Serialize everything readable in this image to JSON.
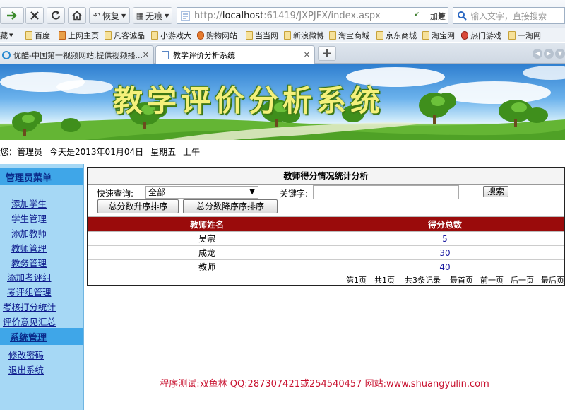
{
  "browser": {
    "nav_buttons": {
      "restore_label": "恢复",
      "no_trace_label": "无痕"
    },
    "url": {
      "scheme_host": "http://",
      "host": "localhost",
      "port_path": ":61419/JXPJFX/index.aspx"
    },
    "accelerate_label": "加速",
    "search_placeholder": "输入文字，直接搜索",
    "favorites": {
      "folder_label": "藏",
      "items": [
        "百度",
        "上网主页",
        "凡客诚品",
        "小游戏大",
        "购物网站",
        "当当网",
        "新浪微博",
        "淘宝商城",
        "京东商城",
        "淘宝网",
        "热门游戏",
        "一淘网"
      ]
    },
    "tabs": [
      {
        "label": "优酷-中国第一视频网站,提供视频播..."
      },
      {
        "label": "教学评价分析系统"
      }
    ]
  },
  "banner": {
    "title": "教学评价分析系统"
  },
  "info_bar": {
    "greeting": "您：管理员",
    "date": "今天是2013年01月04日",
    "weekday": "星期五",
    "period": "上午"
  },
  "sidebar": {
    "admin_menu": "管理员菜单",
    "admin_items": [
      "添加学生",
      "学生管理",
      "添加教师",
      "教师管理",
      "教务管理",
      "添加考评组",
      "考评组管理",
      "考核打分统计",
      "评价意见汇总"
    ],
    "system_menu": "系统管理",
    "system_items": [
      "修改密码",
      "退出系统"
    ]
  },
  "main": {
    "title": "教师得分情况统计分析",
    "quick_query_label": "快速查询:",
    "quick_query_value": "全部",
    "keyword_label": "关键字:",
    "search_button": "搜索",
    "sort_asc_button": "总分数升序排序",
    "sort_desc_button": "总分数降序序排序",
    "table": {
      "headers": [
        "教师姓名",
        "得分总数"
      ],
      "rows": [
        [
          "吴宗",
          "5"
        ],
        [
          "成龙",
          "30"
        ],
        [
          "教师",
          "40"
        ]
      ]
    },
    "pager": {
      "page_info": "第1页",
      "total_pages": "共1页",
      "total_records": "共3条记录",
      "first": "最首页",
      "prev": "前一页",
      "next": "后一页",
      "last": "最后页"
    }
  },
  "footer": {
    "text": "程序测试:双鱼林 QQ:287307421或254540457 网站:www.shuangyulin.com"
  },
  "colors": {
    "table_header": "#9a0b0b",
    "sidebar_bg": "#a6d8f5",
    "sidebar_head": "#3fa6e8",
    "footer_text": "#c8102e",
    "link": "#0d1a8c"
  }
}
